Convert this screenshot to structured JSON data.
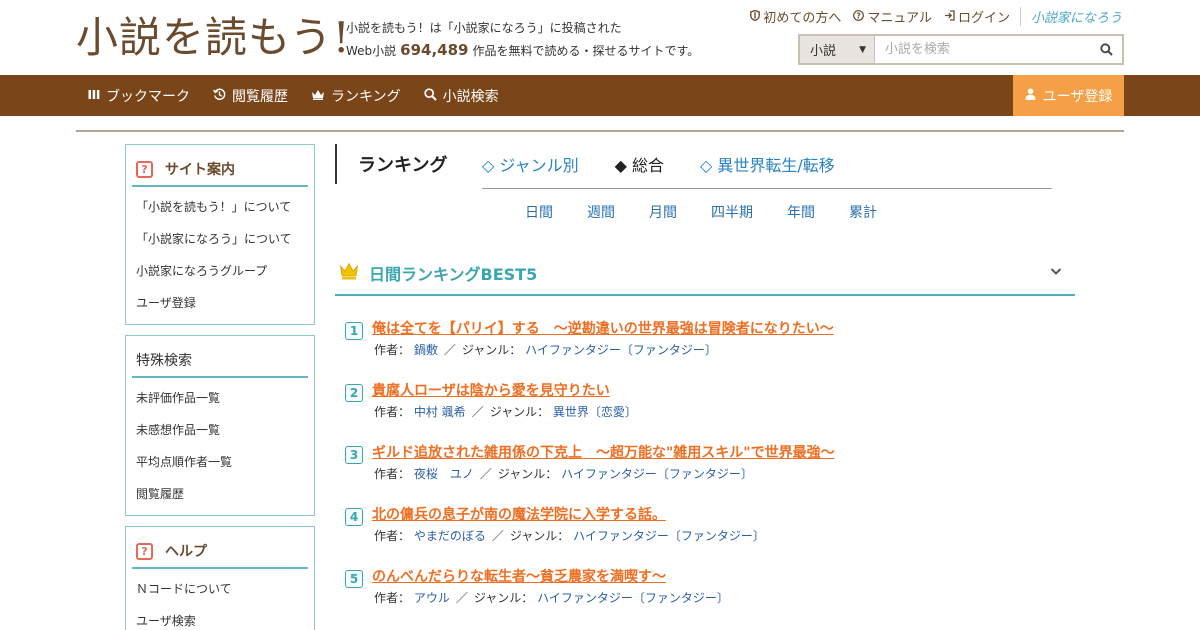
{
  "header": {
    "logo": "小説を読もう!",
    "tagline_line1": "小説を読もう！は「小説家になろう」に投稿された",
    "tagline_prefix": "Web小説",
    "novel_count": "694,489",
    "tagline_suffix": "作品を無料で読める・探せるサイトです。",
    "links": [
      {
        "label": "初めての方へ",
        "icon": "shield-icon"
      },
      {
        "label": "マニュアル",
        "icon": "question-circle-icon"
      },
      {
        "label": "ログイン",
        "icon": "login-icon"
      }
    ],
    "narou_logo": "小説家になろう",
    "search": {
      "category": "小説",
      "placeholder": "小説を検索"
    }
  },
  "nav": {
    "items": [
      {
        "label": "ブックマーク",
        "icon": "bookmark-icon"
      },
      {
        "label": "閲覧履歴",
        "icon": "history-icon"
      },
      {
        "label": "ランキング",
        "icon": "crown-icon"
      },
      {
        "label": "小説検索",
        "icon": "search-icon"
      }
    ],
    "register": "ユーザ登録"
  },
  "sidebar": {
    "site_info": {
      "title": "サイト案内",
      "items": [
        "「小説を読もう！」について",
        "「小説家になろう」について",
        "小説家になろうグループ",
        "ユーザ登録"
      ]
    },
    "special_search": {
      "title": "特殊検索",
      "items": [
        "未評価作品一覧",
        "未感想作品一覧",
        "平均点順作者一覧",
        "閲覧履歴"
      ]
    },
    "help": {
      "title": "ヘルプ",
      "items": [
        "Ｎコードについて",
        "ユーザ検索"
      ]
    }
  },
  "ranking": {
    "title": "ランキング",
    "tabs": [
      {
        "label": "◇ ジャンル別",
        "active": false
      },
      {
        "label": "◆ 総合",
        "active": true
      },
      {
        "label": "◇ 異世界転生/転移",
        "active": false
      }
    ],
    "periods": [
      "日間",
      "週間",
      "月間",
      "四半期",
      "年間",
      "累計"
    ],
    "section_title": "日間ランキングBEST5",
    "author_label": "作者：",
    "genre_label": "ジャンル：",
    "entries": [
      {
        "rank": "1",
        "title": "俺は全てを【パリイ】する　〜逆勘違いの世界最強は冒険者になりたい〜",
        "author": "鍋敷",
        "genre": "ハイファンタジー〔ファンタジー〕"
      },
      {
        "rank": "2",
        "title": "貴腐人ローザは陰から愛を見守りたい",
        "author": "中村 颯希",
        "genre": "異世界〔恋愛〕"
      },
      {
        "rank": "3",
        "title": "ギルド追放された雑用係の下克上　～超万能な\"雑用スキル\"で世界最強～",
        "author": "夜桜　ユノ",
        "genre": "ハイファンタジー〔ファンタジー〕"
      },
      {
        "rank": "4",
        "title": "北の傭兵の息子が南の魔法学院に入学する話。",
        "author": "やまだのぼる",
        "genre": "ハイファンタジー〔ファンタジー〕"
      },
      {
        "rank": "5",
        "title": "のんべんだらりな転生者～貧乏農家を満喫す～",
        "author": "アウル",
        "genre": "ハイファンタジー〔ファンタジー〕"
      }
    ]
  },
  "colors": {
    "brown": "#7a4518",
    "orange": "#f5a046",
    "teal": "#3aa6ad",
    "title_orange": "#ef6f22"
  }
}
